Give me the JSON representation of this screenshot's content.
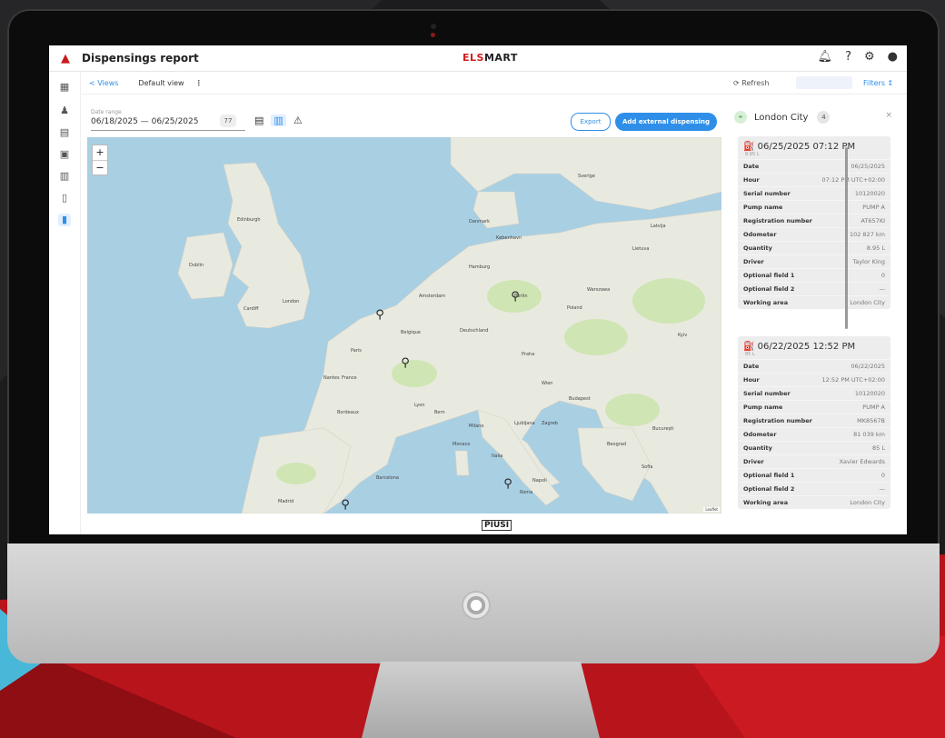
{
  "app": {
    "title": "Dispensings report",
    "logo_text_a": "ELS",
    "logo_text_b": "MART",
    "footer_logo": "PIUSI"
  },
  "toolbar": {
    "views": "< Views",
    "default_view": "Default view",
    "more": "⋮",
    "refresh": "⟳ Refresh",
    "filters": "Filters ↕"
  },
  "date_range": {
    "label": "Date range",
    "value": "06/18/2025 — 06/25/2025",
    "badge": "77"
  },
  "buttons": {
    "export": "Export",
    "add_external": "Add external dispensing"
  },
  "map": {
    "zoom_in": "+",
    "zoom_out": "−",
    "attribution": "Leaflet",
    "labels": [
      "Edinburgh",
      "Dublin",
      "Cardiff",
      "London",
      "Paris",
      "France",
      "Berlin",
      "Poland",
      "Warszawa",
      "Madrid",
      "Roma",
      "Italia",
      "Bern",
      "Praha",
      "Wien",
      "Budapest",
      "Hamburg",
      "Amsterdam",
      "Belgique",
      "Deutschland",
      "København",
      "Danmark",
      "Sverige",
      "Lietuva",
      "Latvija",
      "Beograd",
      "Bucureşti",
      "Sofia",
      "Zagreb",
      "Ljubljana",
      "Kyiv",
      "Monaco",
      "Barcelona",
      "Lyon",
      "Bordeaux",
      "Nantes",
      "Milano",
      "Napoli"
    ]
  },
  "panel": {
    "location": "London City",
    "count": "4",
    "close": "×",
    "cards": [
      {
        "title": "06/25/2025 07:12 PM",
        "subtitle": "8.95 L",
        "rows": [
          {
            "k": "Date",
            "v": "06/25/2025"
          },
          {
            "k": "Hour",
            "v": "07:12 PM UTC+02:00"
          },
          {
            "k": "Serial number",
            "v": "10120020"
          },
          {
            "k": "Pump name",
            "v": "PUMP A"
          },
          {
            "k": "Registration number",
            "v": "AT657KI"
          },
          {
            "k": "Odometer",
            "v": "102 827 km"
          },
          {
            "k": "Quantity",
            "v": "8.95 L"
          },
          {
            "k": "Driver",
            "v": "Taylor King"
          },
          {
            "k": "Optional field 1",
            "v": "0"
          },
          {
            "k": "Optional field 2",
            "v": "—"
          },
          {
            "k": "Working area",
            "v": "London City"
          }
        ]
      },
      {
        "title": "06/22/2025 12:52 PM",
        "subtitle": "85 L",
        "rows": [
          {
            "k": "Date",
            "v": "06/22/2025"
          },
          {
            "k": "Hour",
            "v": "12:52 PM UTC+02:00"
          },
          {
            "k": "Serial number",
            "v": "10120020"
          },
          {
            "k": "Pump name",
            "v": "PUMP A"
          },
          {
            "k": "Registration number",
            "v": "MK8567B"
          },
          {
            "k": "Odometer",
            "v": "81 039 km"
          },
          {
            "k": "Quantity",
            "v": "85 L"
          },
          {
            "k": "Driver",
            "v": "Xavier Edwards"
          },
          {
            "k": "Optional field 1",
            "v": "0"
          },
          {
            "k": "Optional field 2",
            "v": "—"
          },
          {
            "k": "Working area",
            "v": "London City"
          }
        ]
      }
    ]
  },
  "colors": {
    "accent": "#2f8fe8",
    "brand_red": "#c81a1a",
    "background_red": "#b8141c"
  }
}
